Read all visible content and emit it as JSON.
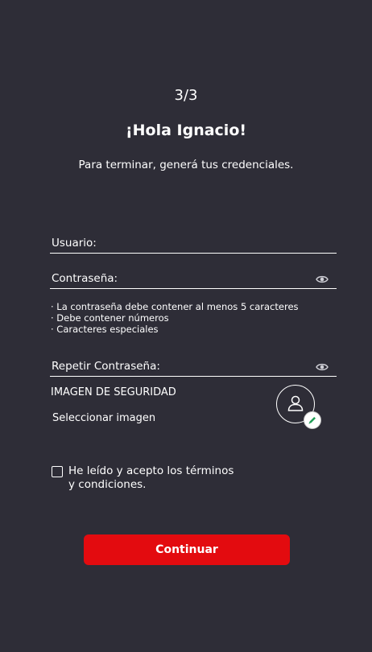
{
  "header": {
    "step": "3/3",
    "greeting": "¡Hola Ignacio!",
    "subtitle": "Para terminar, generá tus credenciales."
  },
  "form": {
    "username_label": "Usuario:",
    "password_label": "Contraseña:",
    "password_rules": [
      "· La contraseña debe contener al menos 5 caracteres",
      "· Debe contener números",
      "· Caracteres especiales"
    ],
    "repeat_password_label": "Repetir Contraseña:"
  },
  "security_image": {
    "title": "IMAGEN DE SEGURIDAD",
    "select_label": "Seleccionar imagen"
  },
  "terms": {
    "label": "He leído y acepto los términos y condiciones."
  },
  "actions": {
    "continue_label": "Continuar"
  },
  "colors": {
    "background": "#2e2d37",
    "primary_button": "#e30b0f",
    "edit_badge_icon": "#1f9d55"
  },
  "icons": {
    "password_visibility": "eye-icon",
    "repeat_password_visibility": "eye-icon",
    "avatar": "user-icon",
    "edit": "pencil-icon"
  }
}
